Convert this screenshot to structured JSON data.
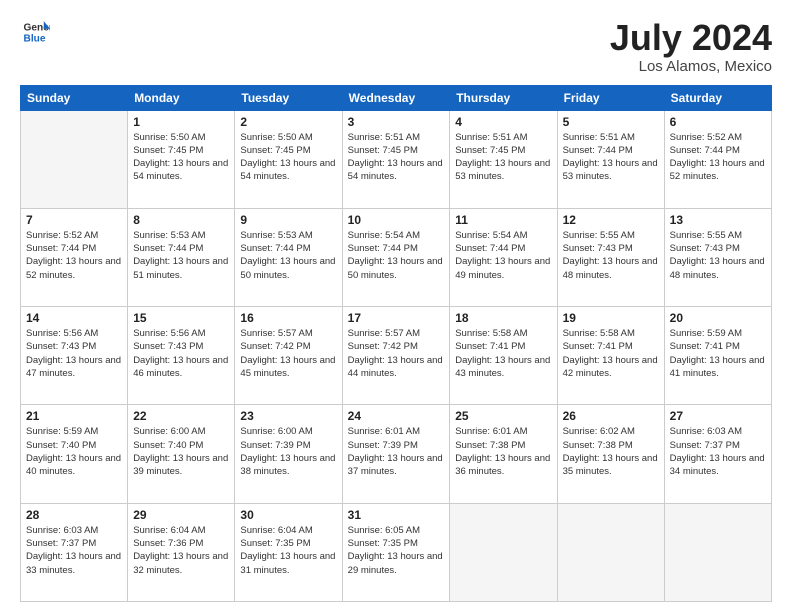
{
  "header": {
    "logo_general": "General",
    "logo_blue": "Blue",
    "month_title": "July 2024",
    "location": "Los Alamos, Mexico"
  },
  "days_of_week": [
    "Sunday",
    "Monday",
    "Tuesday",
    "Wednesday",
    "Thursday",
    "Friday",
    "Saturday"
  ],
  "weeks": [
    [
      {
        "num": "",
        "empty": true
      },
      {
        "num": "1",
        "sunrise": "Sunrise: 5:50 AM",
        "sunset": "Sunset: 7:45 PM",
        "daylight": "Daylight: 13 hours and 54 minutes."
      },
      {
        "num": "2",
        "sunrise": "Sunrise: 5:50 AM",
        "sunset": "Sunset: 7:45 PM",
        "daylight": "Daylight: 13 hours and 54 minutes."
      },
      {
        "num": "3",
        "sunrise": "Sunrise: 5:51 AM",
        "sunset": "Sunset: 7:45 PM",
        "daylight": "Daylight: 13 hours and 54 minutes."
      },
      {
        "num": "4",
        "sunrise": "Sunrise: 5:51 AM",
        "sunset": "Sunset: 7:45 PM",
        "daylight": "Daylight: 13 hours and 53 minutes."
      },
      {
        "num": "5",
        "sunrise": "Sunrise: 5:51 AM",
        "sunset": "Sunset: 7:44 PM",
        "daylight": "Daylight: 13 hours and 53 minutes."
      },
      {
        "num": "6",
        "sunrise": "Sunrise: 5:52 AM",
        "sunset": "Sunset: 7:44 PM",
        "daylight": "Daylight: 13 hours and 52 minutes."
      }
    ],
    [
      {
        "num": "7",
        "sunrise": "Sunrise: 5:52 AM",
        "sunset": "Sunset: 7:44 PM",
        "daylight": "Daylight: 13 hours and 52 minutes."
      },
      {
        "num": "8",
        "sunrise": "Sunrise: 5:53 AM",
        "sunset": "Sunset: 7:44 PM",
        "daylight": "Daylight: 13 hours and 51 minutes."
      },
      {
        "num": "9",
        "sunrise": "Sunrise: 5:53 AM",
        "sunset": "Sunset: 7:44 PM",
        "daylight": "Daylight: 13 hours and 50 minutes."
      },
      {
        "num": "10",
        "sunrise": "Sunrise: 5:54 AM",
        "sunset": "Sunset: 7:44 PM",
        "daylight": "Daylight: 13 hours and 50 minutes."
      },
      {
        "num": "11",
        "sunrise": "Sunrise: 5:54 AM",
        "sunset": "Sunset: 7:44 PM",
        "daylight": "Daylight: 13 hours and 49 minutes."
      },
      {
        "num": "12",
        "sunrise": "Sunrise: 5:55 AM",
        "sunset": "Sunset: 7:43 PM",
        "daylight": "Daylight: 13 hours and 48 minutes."
      },
      {
        "num": "13",
        "sunrise": "Sunrise: 5:55 AM",
        "sunset": "Sunset: 7:43 PM",
        "daylight": "Daylight: 13 hours and 48 minutes."
      }
    ],
    [
      {
        "num": "14",
        "sunrise": "Sunrise: 5:56 AM",
        "sunset": "Sunset: 7:43 PM",
        "daylight": "Daylight: 13 hours and 47 minutes."
      },
      {
        "num": "15",
        "sunrise": "Sunrise: 5:56 AM",
        "sunset": "Sunset: 7:43 PM",
        "daylight": "Daylight: 13 hours and 46 minutes."
      },
      {
        "num": "16",
        "sunrise": "Sunrise: 5:57 AM",
        "sunset": "Sunset: 7:42 PM",
        "daylight": "Daylight: 13 hours and 45 minutes."
      },
      {
        "num": "17",
        "sunrise": "Sunrise: 5:57 AM",
        "sunset": "Sunset: 7:42 PM",
        "daylight": "Daylight: 13 hours and 44 minutes."
      },
      {
        "num": "18",
        "sunrise": "Sunrise: 5:58 AM",
        "sunset": "Sunset: 7:41 PM",
        "daylight": "Daylight: 13 hours and 43 minutes."
      },
      {
        "num": "19",
        "sunrise": "Sunrise: 5:58 AM",
        "sunset": "Sunset: 7:41 PM",
        "daylight": "Daylight: 13 hours and 42 minutes."
      },
      {
        "num": "20",
        "sunrise": "Sunrise: 5:59 AM",
        "sunset": "Sunset: 7:41 PM",
        "daylight": "Daylight: 13 hours and 41 minutes."
      }
    ],
    [
      {
        "num": "21",
        "sunrise": "Sunrise: 5:59 AM",
        "sunset": "Sunset: 7:40 PM",
        "daylight": "Daylight: 13 hours and 40 minutes."
      },
      {
        "num": "22",
        "sunrise": "Sunrise: 6:00 AM",
        "sunset": "Sunset: 7:40 PM",
        "daylight": "Daylight: 13 hours and 39 minutes."
      },
      {
        "num": "23",
        "sunrise": "Sunrise: 6:00 AM",
        "sunset": "Sunset: 7:39 PM",
        "daylight": "Daylight: 13 hours and 38 minutes."
      },
      {
        "num": "24",
        "sunrise": "Sunrise: 6:01 AM",
        "sunset": "Sunset: 7:39 PM",
        "daylight": "Daylight: 13 hours and 37 minutes."
      },
      {
        "num": "25",
        "sunrise": "Sunrise: 6:01 AM",
        "sunset": "Sunset: 7:38 PM",
        "daylight": "Daylight: 13 hours and 36 minutes."
      },
      {
        "num": "26",
        "sunrise": "Sunrise: 6:02 AM",
        "sunset": "Sunset: 7:38 PM",
        "daylight": "Daylight: 13 hours and 35 minutes."
      },
      {
        "num": "27",
        "sunrise": "Sunrise: 6:03 AM",
        "sunset": "Sunset: 7:37 PM",
        "daylight": "Daylight: 13 hours and 34 minutes."
      }
    ],
    [
      {
        "num": "28",
        "sunrise": "Sunrise: 6:03 AM",
        "sunset": "Sunset: 7:37 PM",
        "daylight": "Daylight: 13 hours and 33 minutes."
      },
      {
        "num": "29",
        "sunrise": "Sunrise: 6:04 AM",
        "sunset": "Sunset: 7:36 PM",
        "daylight": "Daylight: 13 hours and 32 minutes."
      },
      {
        "num": "30",
        "sunrise": "Sunrise: 6:04 AM",
        "sunset": "Sunset: 7:35 PM",
        "daylight": "Daylight: 13 hours and 31 minutes."
      },
      {
        "num": "31",
        "sunrise": "Sunrise: 6:05 AM",
        "sunset": "Sunset: 7:35 PM",
        "daylight": "Daylight: 13 hours and 29 minutes."
      },
      {
        "num": "",
        "empty": true
      },
      {
        "num": "",
        "empty": true
      },
      {
        "num": "",
        "empty": true
      }
    ]
  ]
}
